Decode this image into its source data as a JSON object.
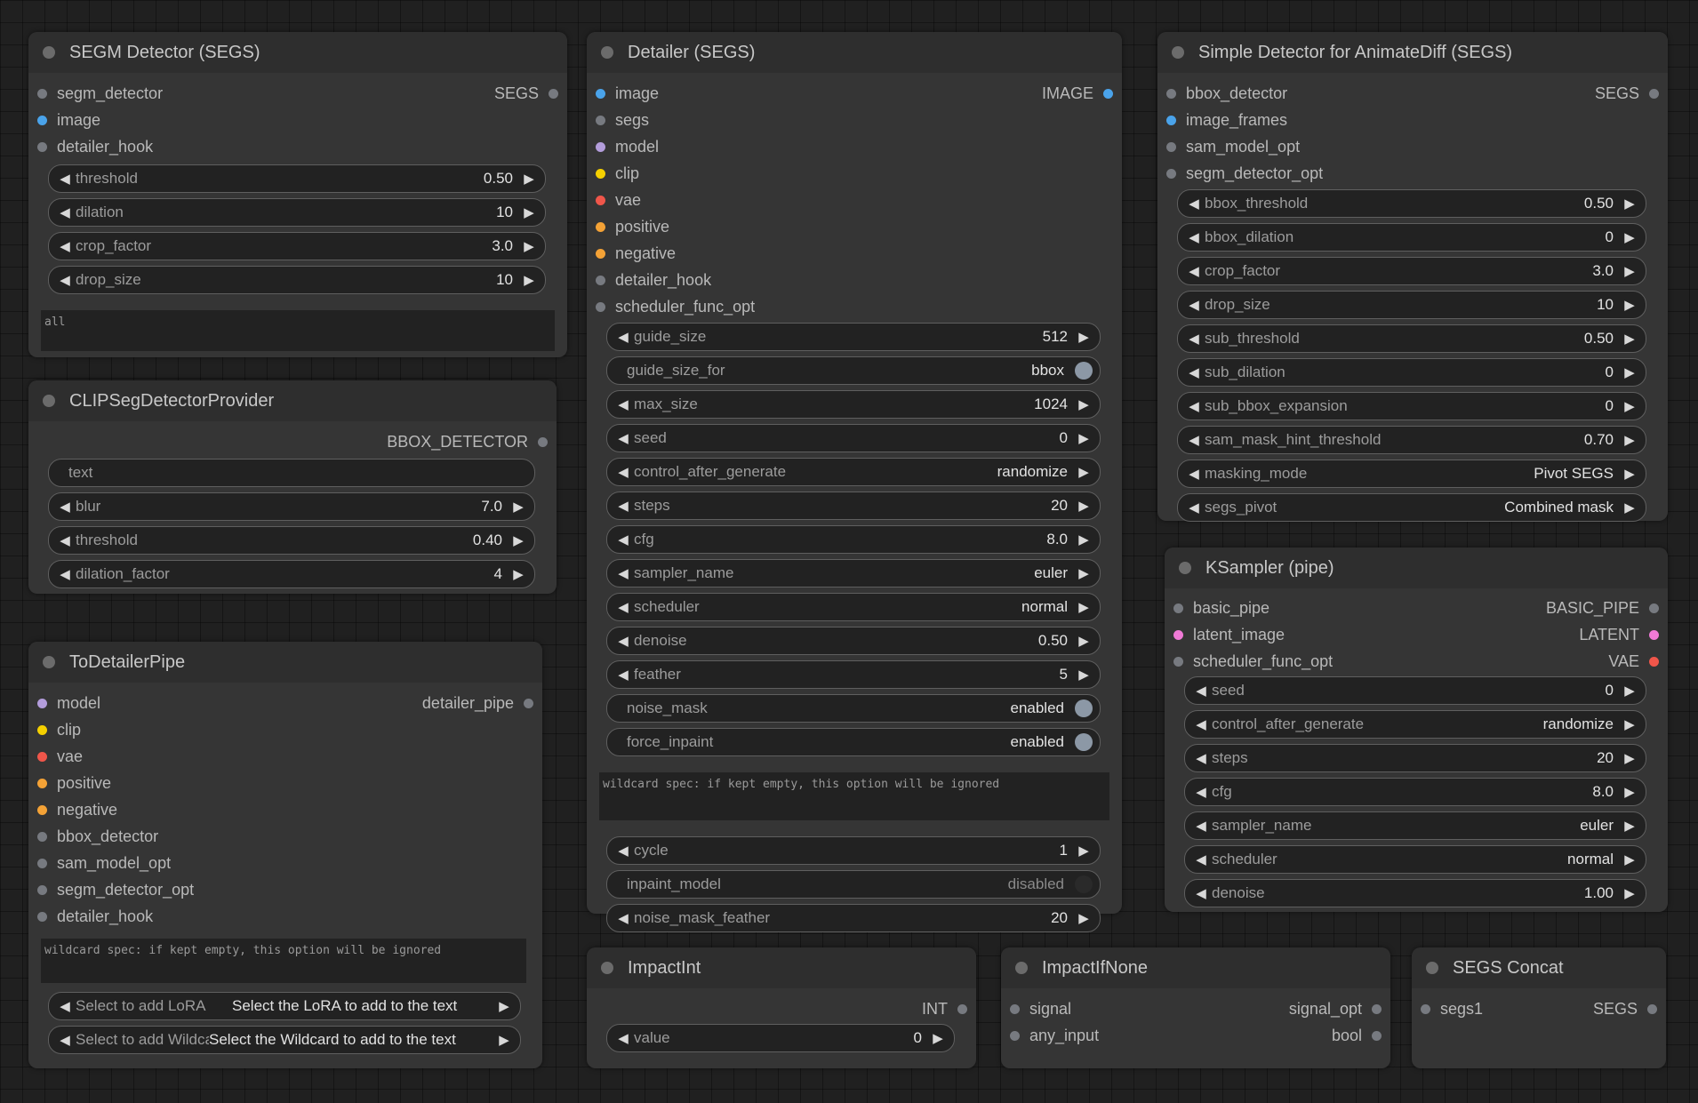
{
  "colors": {
    "IMAGE": "#4aa3ea",
    "SEGS": "#777a80",
    "HOOK": "#777a80",
    "MODEL": "#b39ddb",
    "CLIP": "#f5d000",
    "VAE": "#f0564a",
    "CONDITIONING": "#f4a236",
    "LATENT": "#f07ad6",
    "OTHER": "#777a80",
    "toggle_on": "#8c98a6",
    "toggle_off": "#2a2a2a"
  },
  "segm": {
    "title": "SEGM Detector (SEGS)",
    "inputs": [
      "segm_detector",
      "image",
      "detailer_hook"
    ],
    "output": "SEGS",
    "widgets": [
      {
        "label": "threshold",
        "value": "0.50"
      },
      {
        "label": "dilation",
        "value": "10"
      },
      {
        "label": "crop_factor",
        "value": "3.0"
      },
      {
        "label": "drop_size",
        "value": "10"
      }
    ],
    "text": "all"
  },
  "clipseg": {
    "title": "CLIPSegDetectorProvider",
    "output": "BBOX_DETECTOR",
    "text_placeholder": "text",
    "widgets": [
      {
        "label": "blur",
        "value": "7.0"
      },
      {
        "label": "threshold",
        "value": "0.40"
      },
      {
        "label": "dilation_factor",
        "value": "4"
      }
    ]
  },
  "todetailer": {
    "title": "ToDetailerPipe",
    "inputs": [
      "model",
      "clip",
      "vae",
      "positive",
      "negative",
      "bbox_detector",
      "sam_model_opt",
      "segm_detector_opt",
      "detailer_hook"
    ],
    "output": "detailer_pipe",
    "wildcard_text": "wildcard spec: if kept empty, this option will be ignored",
    "lora_label": "Select to add LoRA",
    "lora_value": "Select the LoRA to add to the text",
    "wildcard_label": "Select to add Wildcard",
    "wildcard_value": "Select the Wildcard to add to the text"
  },
  "detailer": {
    "title": "Detailer (SEGS)",
    "inputs": [
      "image",
      "segs",
      "model",
      "clip",
      "vae",
      "positive",
      "negative",
      "detailer_hook",
      "scheduler_func_opt"
    ],
    "output": "IMAGE",
    "widgets_a": [
      {
        "label": "guide_size",
        "value": "512"
      },
      {
        "label": "guide_size_for",
        "value": "bbox",
        "toggle": true,
        "on": true
      },
      {
        "label": "max_size",
        "value": "1024"
      },
      {
        "label": "seed",
        "value": "0"
      },
      {
        "label": "control_after_generate",
        "value": "randomize"
      },
      {
        "label": "steps",
        "value": "20"
      },
      {
        "label": "cfg",
        "value": "8.0"
      },
      {
        "label": "sampler_name",
        "value": "euler"
      },
      {
        "label": "scheduler",
        "value": "normal"
      },
      {
        "label": "denoise",
        "value": "0.50"
      },
      {
        "label": "feather",
        "value": "5"
      },
      {
        "label": "noise_mask",
        "value": "enabled",
        "toggle": true,
        "on": true
      },
      {
        "label": "force_inpaint",
        "value": "enabled",
        "toggle": true,
        "on": true
      }
    ],
    "wildcard_text": "wildcard spec: if kept empty, this option will be ignored",
    "widgets_b": [
      {
        "label": "cycle",
        "value": "1"
      },
      {
        "label": "inpaint_model",
        "value": "disabled",
        "toggle": true,
        "on": false
      },
      {
        "label": "noise_mask_feather",
        "value": "20"
      }
    ]
  },
  "simple": {
    "title": "Simple Detector for AnimateDiff (SEGS)",
    "inputs": [
      "bbox_detector",
      "image_frames",
      "sam_model_opt",
      "segm_detector_opt"
    ],
    "output": "SEGS",
    "widgets": [
      {
        "label": "bbox_threshold",
        "value": "0.50"
      },
      {
        "label": "bbox_dilation",
        "value": "0"
      },
      {
        "label": "crop_factor",
        "value": "3.0"
      },
      {
        "label": "drop_size",
        "value": "10"
      },
      {
        "label": "sub_threshold",
        "value": "0.50"
      },
      {
        "label": "sub_dilation",
        "value": "0"
      },
      {
        "label": "sub_bbox_expansion",
        "value": "0"
      },
      {
        "label": "sam_mask_hint_threshold",
        "value": "0.70"
      },
      {
        "label": "masking_mode",
        "value": "Pivot SEGS"
      },
      {
        "label": "segs_pivot",
        "value": "Combined mask"
      }
    ]
  },
  "ksampler": {
    "title": "KSampler (pipe)",
    "rows": [
      {
        "in": "basic_pipe",
        "out": "BASIC_PIPE"
      },
      {
        "in": "latent_image",
        "out": "LATENT"
      },
      {
        "in": "scheduler_func_opt",
        "out": "VAE"
      }
    ],
    "widgets": [
      {
        "label": "seed",
        "value": "0"
      },
      {
        "label": "control_after_generate",
        "value": "randomize"
      },
      {
        "label": "steps",
        "value": "20"
      },
      {
        "label": "cfg",
        "value": "8.0"
      },
      {
        "label": "sampler_name",
        "value": "euler"
      },
      {
        "label": "scheduler",
        "value": "normal"
      },
      {
        "label": "denoise",
        "value": "1.00"
      }
    ]
  },
  "impactint": {
    "title": "ImpactInt",
    "output": "INT",
    "widget": {
      "label": "value",
      "value": "0"
    }
  },
  "ifnone": {
    "title": "ImpactIfNone",
    "rows": [
      {
        "in": "signal",
        "out": "signal_opt"
      },
      {
        "in": "any_input",
        "out": "bool"
      }
    ]
  },
  "concat": {
    "title": "SEGS Concat",
    "input": "segs1",
    "output": "SEGS"
  }
}
